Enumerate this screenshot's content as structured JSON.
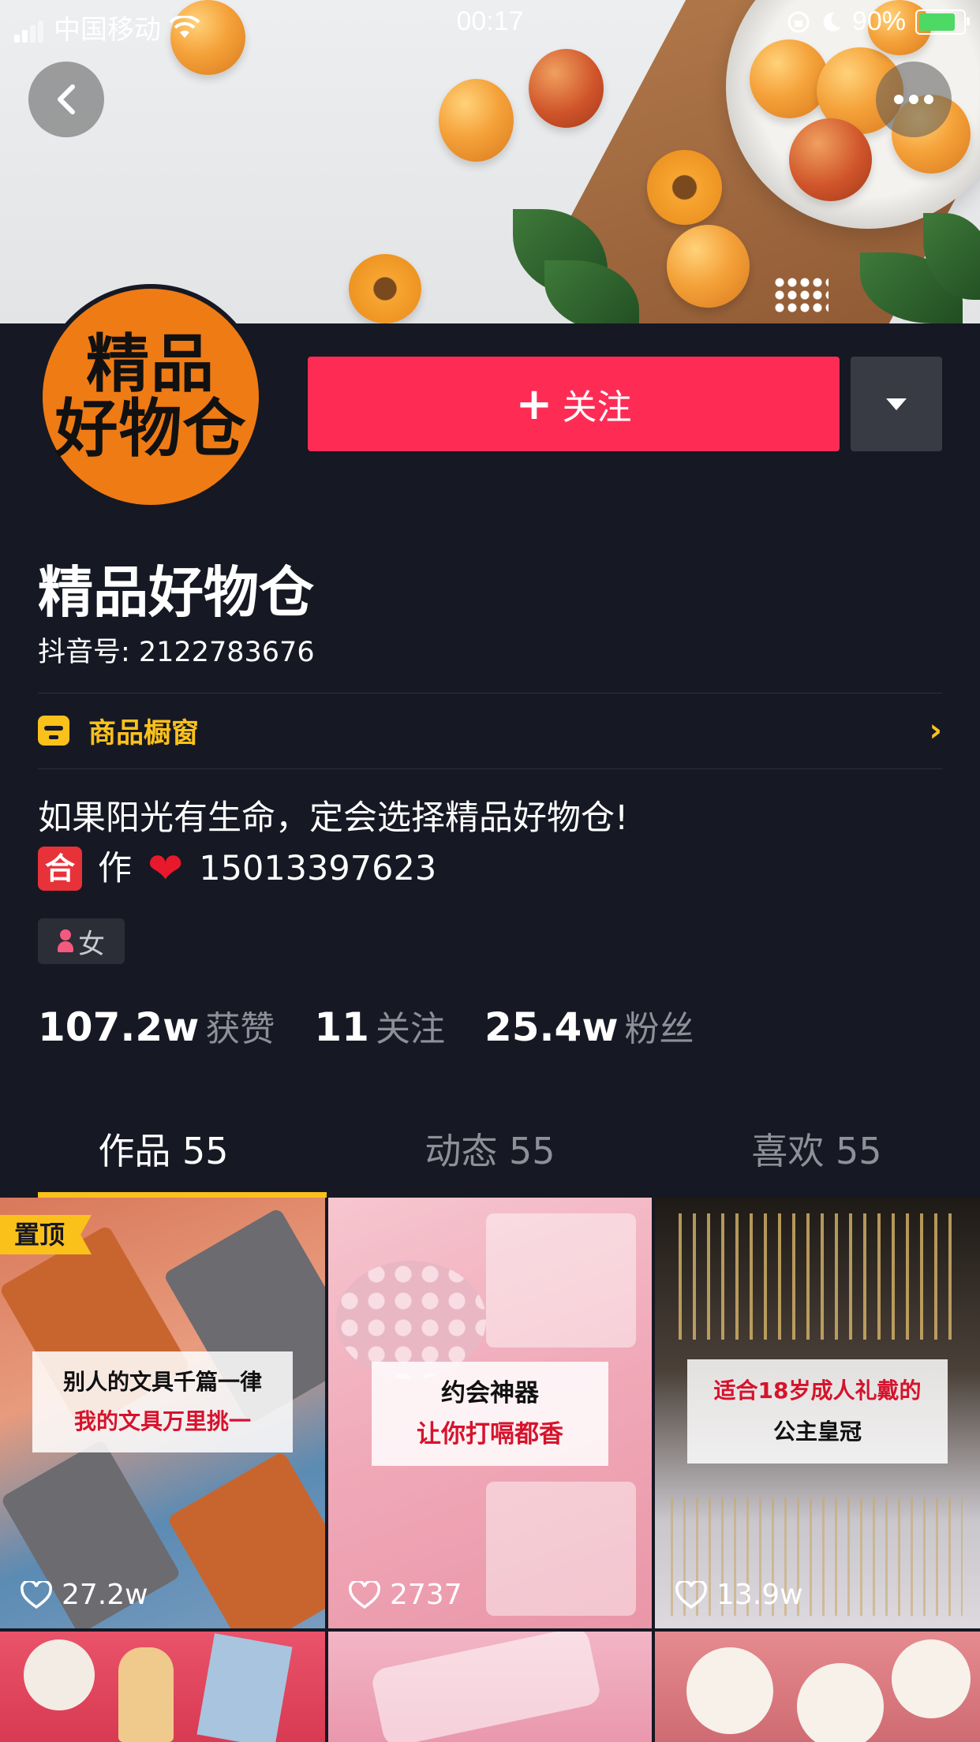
{
  "status_bar": {
    "carrier": "中国移动",
    "time": "00:17",
    "battery": "90%"
  },
  "profile": {
    "avatar_line1": "精品",
    "avatar_line2": "好物仓",
    "follow_label": "关注",
    "name": "精品好物仓",
    "douyin_id": "抖音号: 2122783676",
    "shop_label": "商品橱窗",
    "bio_line1": "如果阳光有生命，定会选择精品好物仓!",
    "bio_he": "合",
    "bio_zuo": "作",
    "bio_heart": "❤",
    "bio_phone": "15013397623",
    "gender": "女"
  },
  "stats": [
    {
      "num": "107.2w",
      "label": "获赞"
    },
    {
      "num": "11",
      "label": "关注"
    },
    {
      "num": "25.4w",
      "label": "粉丝"
    }
  ],
  "tabs": [
    {
      "label": "作品 55",
      "active": true
    },
    {
      "label": "动态 55",
      "active": false
    },
    {
      "label": "喜欢 55",
      "active": false
    }
  ],
  "videos": [
    {
      "pin": "置顶",
      "caption1": "别人的文具千篇一律",
      "caption2": "我的文具万里挑一",
      "likes": "27.2w"
    },
    {
      "caption1": "约会神器",
      "caption2": "让你打嗝都香",
      "likes": "2737"
    },
    {
      "caption1": "适合18岁成人礼戴的",
      "caption2": "公主皇冠",
      "likes": "13.9w"
    }
  ],
  "icons": [
    "back-arrow-icon",
    "more-dots-icon",
    "shop-icon",
    "chevron-right-icon",
    "heart-icon",
    "dropdown-triangle-icon"
  ],
  "colors": {
    "background": "#161823",
    "follow_button": "#fe2c55",
    "accent_yellow": "#fbc11b",
    "muted_text": "#8e9099"
  }
}
